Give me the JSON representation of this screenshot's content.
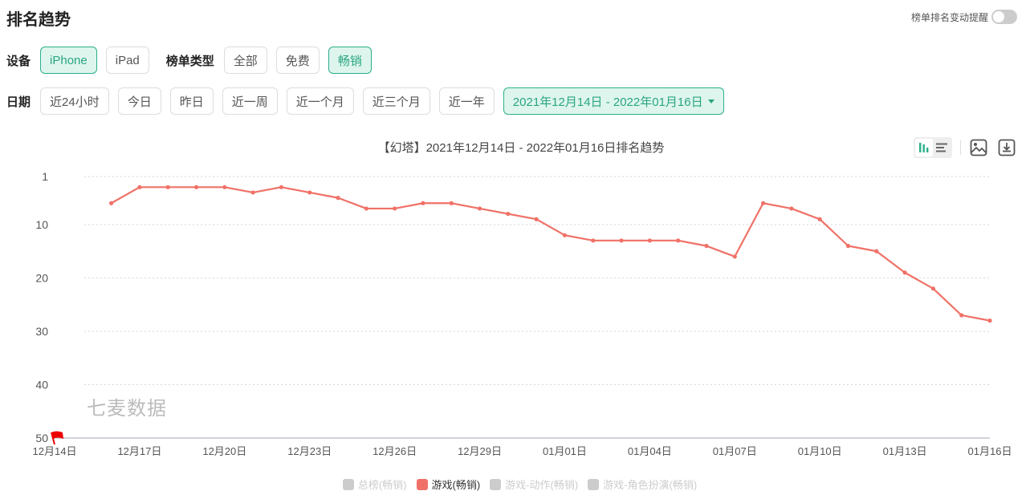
{
  "header": {
    "title": "排名趋势",
    "alert_toggle_label": "榜单排名变动提醒",
    "alert_toggle_on": false
  },
  "filters": {
    "device_label": "设备",
    "devices": [
      {
        "label": "iPhone",
        "active": true
      },
      {
        "label": "iPad",
        "active": false
      }
    ],
    "list_type_label": "榜单类型",
    "list_types": [
      {
        "label": "全部",
        "active": false
      },
      {
        "label": "免费",
        "active": false
      },
      {
        "label": "畅销",
        "active": true
      }
    ],
    "date_label": "日期",
    "date_presets": [
      {
        "label": "近24小时"
      },
      {
        "label": "今日"
      },
      {
        "label": "昨日"
      },
      {
        "label": "近一周"
      },
      {
        "label": "近一个月"
      },
      {
        "label": "近三个月"
      },
      {
        "label": "近一年"
      }
    ],
    "date_range": "2021年12月14日 - 2022年01月16日"
  },
  "toolbar": {
    "icons": [
      "bar-chart-icon",
      "list-view-icon",
      "image-export-icon",
      "download-icon"
    ]
  },
  "watermark": "七麦数据",
  "colors": {
    "accent": "#2bb08a",
    "series": "#f07167",
    "legend_inactive": "#cccccc"
  },
  "chart_data": {
    "type": "line",
    "title": "【幻塔】2021年12月14日 - 2022年01月16日排名趋势",
    "xlabel": "",
    "ylabel": "",
    "y_inverted": true,
    "ylim": [
      1,
      50
    ],
    "y_ticks": [
      1,
      10,
      20,
      30,
      40,
      50
    ],
    "x_tick_labels": [
      "12月14日",
      "12月17日",
      "12月20日",
      "12月23日",
      "12月26日",
      "12月29日",
      "01月01日",
      "01月04日",
      "01月07日",
      "01月10日",
      "01月13日",
      "01月16日"
    ],
    "x": [
      "12月14日",
      "12月15日",
      "12月16日",
      "12月17日",
      "12月18日",
      "12月19日",
      "12月20日",
      "12月21日",
      "12月22日",
      "12月23日",
      "12月24日",
      "12月25日",
      "12月26日",
      "12月27日",
      "12月28日",
      "12月29日",
      "12月30日",
      "12月31日",
      "01月01日",
      "01月02日",
      "01月03日",
      "01月04日",
      "01月05日",
      "01月06日",
      "01月07日",
      "01月08日",
      "01月09日",
      "01月10日",
      "01月11日",
      "01月12日",
      "01月13日",
      "01月14日",
      "01月15日",
      "01月16日"
    ],
    "grid": true,
    "legend_position": "bottom",
    "series": [
      {
        "name": "总榜(畅销)",
        "active": false,
        "values": []
      },
      {
        "name": "游戏(畅销)",
        "active": true,
        "values": [
          null,
          null,
          6,
          3,
          3,
          3,
          3,
          4,
          3,
          4,
          5,
          7,
          7,
          6,
          6,
          7,
          8,
          9,
          12,
          13,
          13,
          13,
          13,
          14,
          16,
          6,
          7,
          9,
          14,
          15,
          19,
          22,
          27,
          28
        ]
      },
      {
        "name": "游戏-动作(畅销)",
        "active": false,
        "values": []
      },
      {
        "name": "游戏-角色扮演(畅销)",
        "active": false,
        "values": []
      }
    ],
    "annotation": "release-flag at 12月14日"
  }
}
